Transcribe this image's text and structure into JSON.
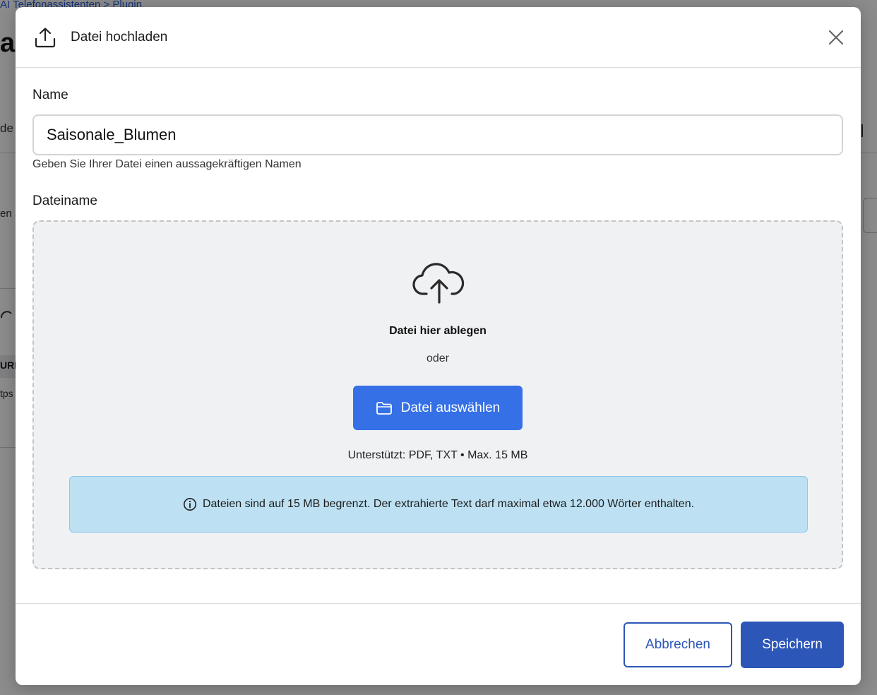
{
  "background": {
    "breadcrumb": "AI Telefonassistenten  >  Plugin",
    "title_fragment": "a",
    "tab_fragment": "de",
    "label_fragment": "en S",
    "table_header_fragment": "URL",
    "table_cell_fragment": "tps"
  },
  "modal": {
    "title": "Datei hochladen",
    "header_icon": "upload-icon",
    "close_icon": "close-icon",
    "name_label": "Name",
    "name_value": "Saisonale_Blumen",
    "name_helper": "Geben Sie Ihrer Datei einen aussagekräftigen Namen",
    "file_label": "Dateiname",
    "dropzone": {
      "icon": "cloud-upload-icon",
      "title": "Datei hier ablegen",
      "or": "oder",
      "choose_button": "Datei auswählen",
      "choose_icon": "folder-icon",
      "supported": "Unterstützt: PDF, TXT • Max. 15 MB",
      "info_icon": "info-icon",
      "info_text": "Dateien sind auf 15 MB begrenzt. Der extrahierte Text darf maximal etwa 12.000 Wörter enthalten."
    },
    "footer": {
      "cancel": "Abbrechen",
      "save": "Speichern"
    }
  },
  "colors": {
    "primary_button": "#3570e6",
    "save_button": "#2c56b8",
    "dropzone_bg": "#f0f1f3",
    "info_bg": "#bde1f3"
  }
}
